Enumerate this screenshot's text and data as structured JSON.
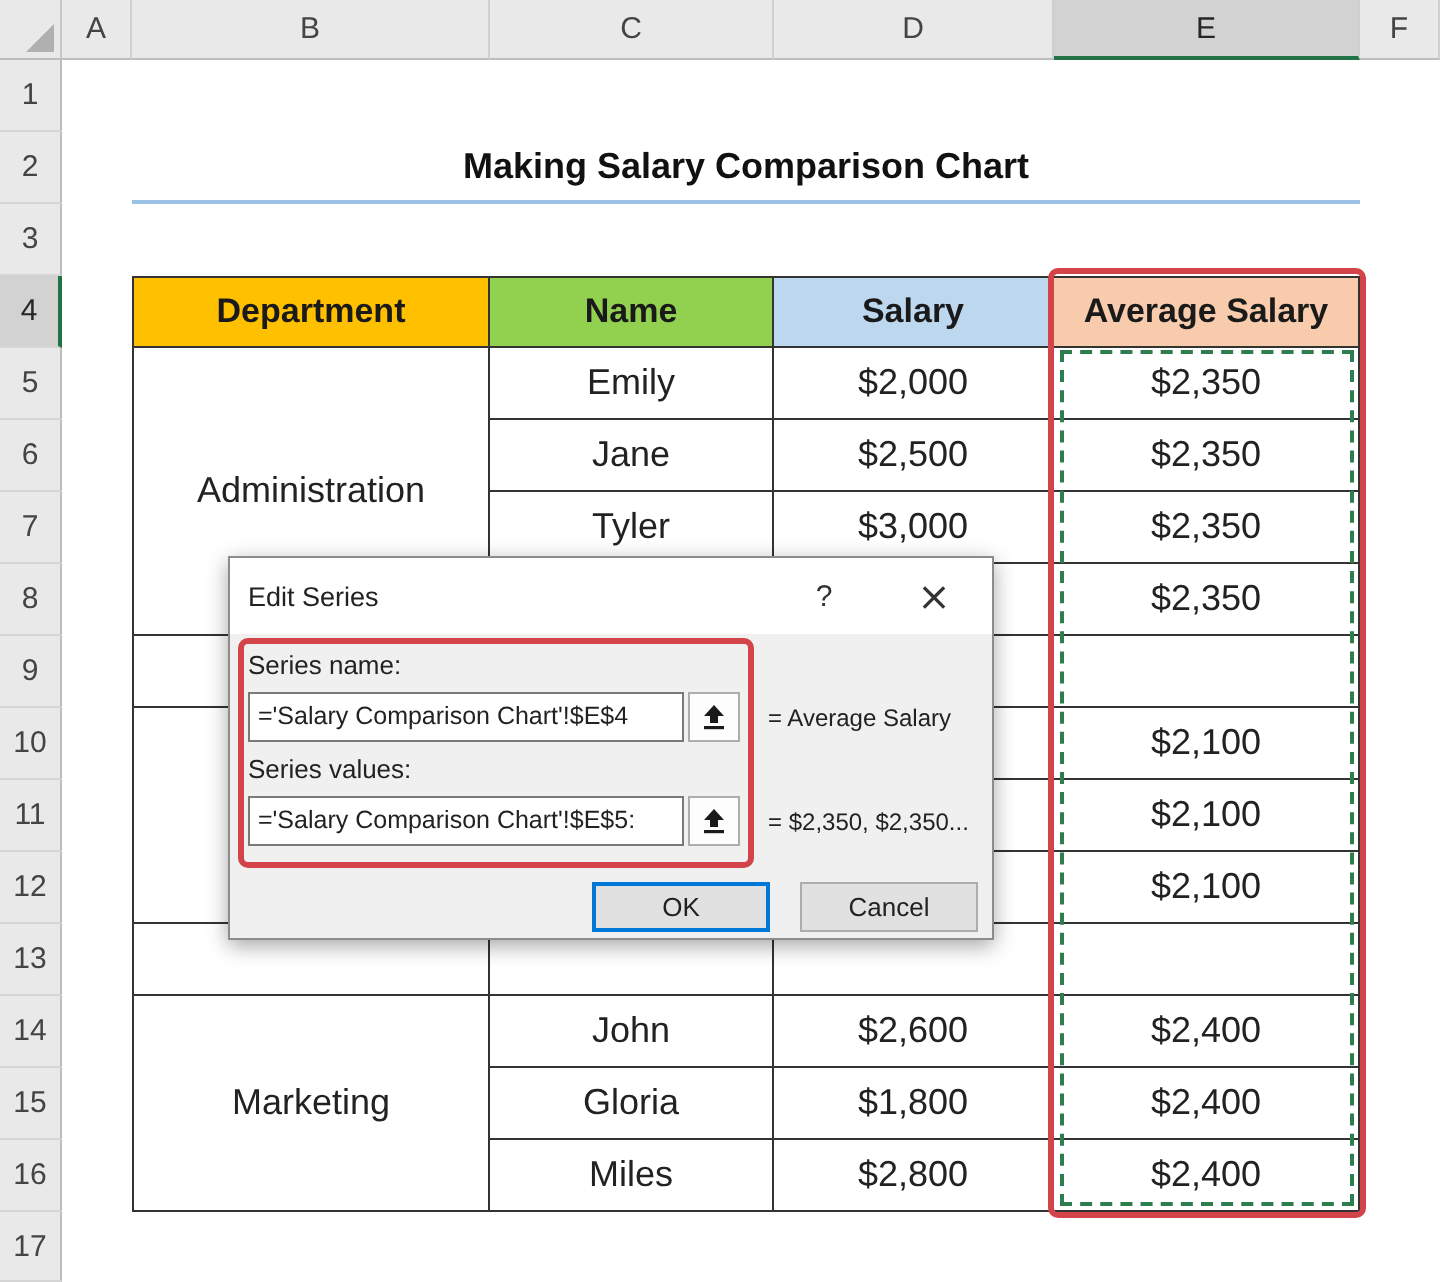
{
  "column_headers": [
    {
      "label": "A",
      "selected": false
    },
    {
      "label": "B",
      "selected": false
    },
    {
      "label": "C",
      "selected": false
    },
    {
      "label": "D",
      "selected": false
    },
    {
      "label": "E",
      "selected": true
    },
    {
      "label": "F",
      "selected": false
    }
  ],
  "row_headers": [
    {
      "label": "1",
      "selected": false
    },
    {
      "label": "2",
      "selected": false
    },
    {
      "label": "3",
      "selected": false
    },
    {
      "label": "4",
      "selected": true
    },
    {
      "label": "5",
      "selected": false
    },
    {
      "label": "6",
      "selected": false
    },
    {
      "label": "7",
      "selected": false
    },
    {
      "label": "8",
      "selected": false
    },
    {
      "label": "9",
      "selected": false
    },
    {
      "label": "10",
      "selected": false
    },
    {
      "label": "11",
      "selected": false
    },
    {
      "label": "12",
      "selected": false
    },
    {
      "label": "13",
      "selected": false
    },
    {
      "label": "14",
      "selected": false
    },
    {
      "label": "15",
      "selected": false
    },
    {
      "label": "16",
      "selected": false
    },
    {
      "label": "17",
      "selected": false
    }
  ],
  "title": "Making Salary Comparison Chart",
  "table": {
    "columns": [
      {
        "label": "Department",
        "color": "#ffc000",
        "outlined": false,
        "marquee": false
      },
      {
        "label": "Name",
        "color": "#92d050",
        "outlined": false,
        "marquee": false
      },
      {
        "label": "Salary",
        "color": "#bdd7ee",
        "outlined": false,
        "marquee": false
      },
      {
        "label": "Average Salary",
        "color": "#f8cbad",
        "outlined": true,
        "marquee": true
      }
    ],
    "sections": [
      {
        "kind": "group",
        "department": "Administration",
        "rows": [
          {
            "name": "Emily",
            "salary": "$2,000",
            "average": "$2,350"
          },
          {
            "name": "Jane",
            "salary": "$2,500",
            "average": "$2,350"
          },
          {
            "name": "Tyler",
            "salary": "$3,000",
            "average": "$2,350"
          },
          {
            "average": "$2,350"
          }
        ]
      },
      {
        "kind": "blank"
      },
      {
        "kind": "group",
        "rows": [
          {
            "average": "$2,100"
          },
          {
            "average": "$2,100"
          },
          {
            "average": "$2,100"
          }
        ]
      },
      {
        "kind": "blank"
      },
      {
        "kind": "group",
        "department": "Marketing",
        "rows": [
          {
            "name": "John",
            "salary": "$2,600",
            "average": "$2,400"
          },
          {
            "name": "Gloria",
            "salary": "$1,800",
            "average": "$2,400"
          },
          {
            "name": "Miles",
            "salary": "$2,800",
            "average": "$2,400"
          }
        ]
      }
    ]
  },
  "dialog": {
    "title": "Edit Series",
    "help": "?",
    "close": "×",
    "fields_outlined": true,
    "fields": [
      {
        "label": "Series name:",
        "value": "='Salary Comparison Chart'!$E$4",
        "result": "= Average Salary"
      },
      {
        "label": "Series values:",
        "value": "='Salary Comparison Chart'!$E$5:",
        "result": "= $2,350, $2,350..."
      }
    ],
    "buttons": [
      {
        "label": "OK",
        "default": true
      },
      {
        "label": "Cancel",
        "default": false
      }
    ]
  }
}
